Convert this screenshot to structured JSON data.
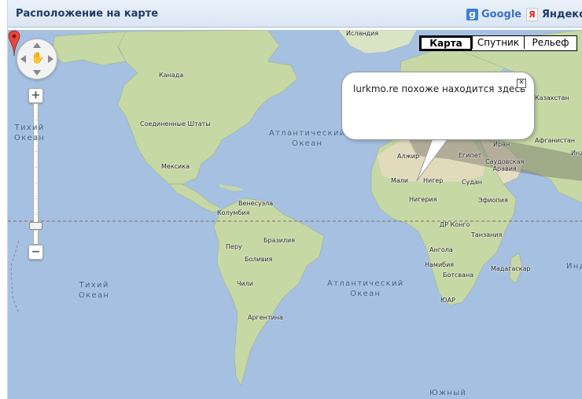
{
  "header": {
    "title": "Расположение на карте",
    "google_badge": "g",
    "google_label": "Google",
    "yandex_badge": "Я",
    "yandex_label": "Яндекс"
  },
  "map_types": [
    {
      "label": "Карта",
      "active": true
    },
    {
      "label": "Спутник",
      "active": false
    },
    {
      "label": "Рельеф",
      "active": false
    }
  ],
  "icons": {
    "pan": "hand-pan-icon",
    "zoom_in": "plus-icon",
    "zoom_out": "minus-icon",
    "marker": "map-pin-icon",
    "close": "close-icon"
  },
  "zoom": {
    "plus": "+",
    "minus": "−"
  },
  "popup": {
    "text": "lurkmo.re похоже находится здесь",
    "close": "✕"
  },
  "places": {
    "iceland": "Исландия",
    "canada": "Канада",
    "usa": "Соединенные Штаты",
    "mexico": "Мексика",
    "venezuela": "Венесуэла",
    "colombia": "Колумбия",
    "brazil": "Бразилия",
    "peru": "Перу",
    "bolivia": "Боливия",
    "chile": "Чили",
    "argentina": "Аргентина",
    "kazakhstan": "Казахстан",
    "afghanistan": "Афганистан",
    "iran": "Иран",
    "egypt": "Египет",
    "saudi": "Саудовская\nАравия",
    "algeria": "Алжир",
    "mali": "Мали",
    "niger": "Нигер",
    "nigeria": "Нигерия",
    "sudan": "Судан",
    "ethiopia": "Эфиопия",
    "drc": "ДР Конго",
    "tanzania": "Танзания",
    "angola": "Ангола",
    "namibia": "Намибия",
    "botswana": "Ботсвана",
    "madagascar": "Мадагаскар",
    "sar": "ЮАР",
    "india": "Индия"
  },
  "oceans": {
    "pacific_n": "Тихий\nОкеан",
    "atlantic_n": "Атлантический\nОкеан",
    "pacific_s": "Тихий\nОкеан",
    "atlantic_s": "Атлантический\nОкеан",
    "southern": "Южный",
    "indian": "Инд"
  },
  "colors": {
    "water": "#a5c0e0",
    "land": "#c6d8a4",
    "desert": "#e6dcc0",
    "header_text": "#1f3a66",
    "google_text": "#3b71c7",
    "marker": "#e8473a"
  }
}
